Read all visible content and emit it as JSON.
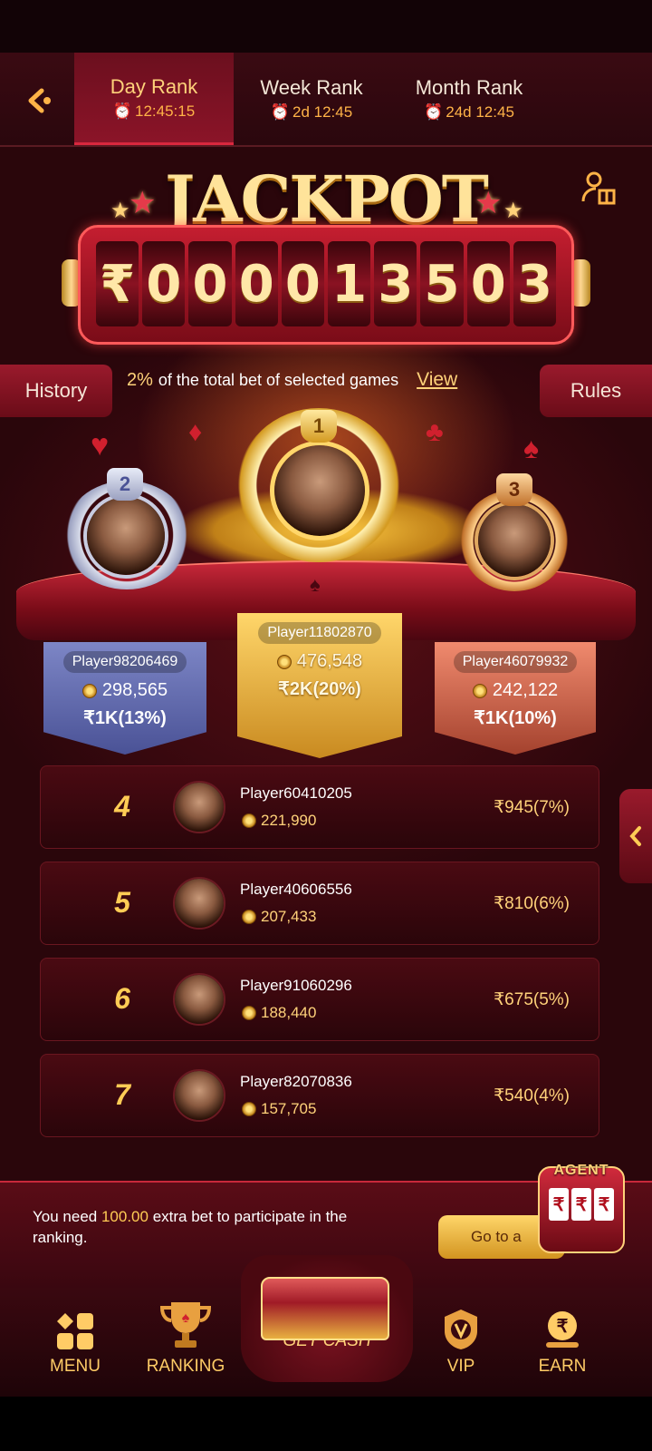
{
  "tabs": [
    {
      "title": "Day Rank",
      "timer": "12:45:15",
      "active": true
    },
    {
      "title": "Week Rank",
      "timer": "2d 12:45",
      "active": false
    },
    {
      "title": "Month Rank",
      "timer": "24d 12:45",
      "active": false
    }
  ],
  "jackpot": {
    "title": "JACKPOT",
    "currency": "₹",
    "digits": [
      "0",
      "0",
      "0",
      "0",
      "1",
      "3",
      "5",
      "0",
      "3"
    ]
  },
  "info": {
    "history_label": "History",
    "rules_label": "Rules",
    "percent": "2%",
    "description": "of the total bet of selected games",
    "view_label": "View"
  },
  "top3": [
    {
      "rank": "1",
      "name": "Player11802870",
      "score": "476,548",
      "prize": "₹2K(20%)"
    },
    {
      "rank": "2",
      "name": "Player98206469",
      "score": "298,565",
      "prize": "₹1K(13%)"
    },
    {
      "rank": "3",
      "name": "Player46079932",
      "score": "242,122",
      "prize": "₹1K(10%)"
    }
  ],
  "ranking": [
    {
      "rank": "4",
      "name": "Player60410205",
      "score": "221,990",
      "prize": "₹945(7%)"
    },
    {
      "rank": "5",
      "name": "Player40606556",
      "score": "207,433",
      "prize": "₹810(6%)"
    },
    {
      "rank": "6",
      "name": "Player91060296",
      "score": "188,440",
      "prize": "₹675(5%)"
    },
    {
      "rank": "7",
      "name": "Player82070836",
      "score": "157,705",
      "prize": "₹540(4%)"
    }
  ],
  "participate": {
    "text_before": "You need",
    "amount": "100.00",
    "text_after": "extra bet to participate in the ranking.",
    "button_label": "Go to a"
  },
  "agent": {
    "label": "AGENT",
    "reels": [
      "₹",
      "₹",
      "₹"
    ]
  },
  "nav": {
    "menu": "MENU",
    "ranking": "RANKING",
    "get_cash": "GET CASH",
    "vip": "VIP",
    "earn": "EARN"
  }
}
